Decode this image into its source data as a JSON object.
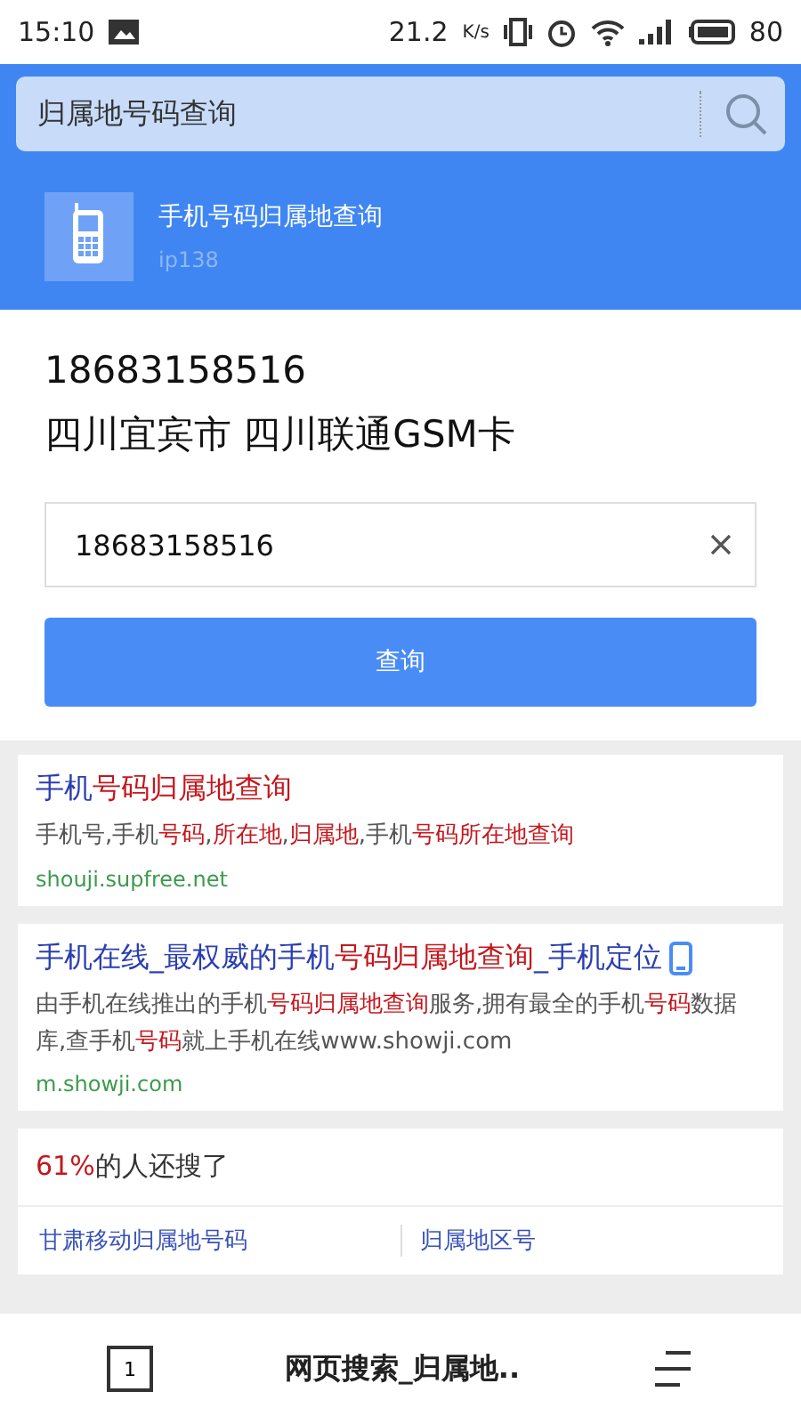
{
  "status_bar": {
    "time": "15:10",
    "speed": "21.2",
    "speed_unit": "K/s",
    "battery": "80"
  },
  "search": {
    "query": "归属地号码查询"
  },
  "app_card": {
    "title": "手机号码归属地查询",
    "source": "ip138"
  },
  "result": {
    "number": "18683158516",
    "location": "四川宜宾市 四川联通GSM卡"
  },
  "lookup": {
    "value": "18683158516",
    "button": "查询"
  },
  "results": [
    {
      "title": "手机**号码归属地查询**",
      "snippet": "手机号,手机**号码**,**所在地**,**归属地**,手机**号码所在地查询**",
      "url": "shouji.supfree.net",
      "mobile_badge": false
    },
    {
      "title": "手机在线_最权威的手机**号码归属地查询**_手机定位",
      "snippet": "由手机在线推出的手机**号码归属地查询**服务,拥有最全的手机**号码**数据库,查手机**号码**就上手机在线www.showji.com",
      "url": "m.showji.com",
      "mobile_badge": true
    }
  ],
  "related": {
    "percent": "61%",
    "label": "的人还搜了",
    "items": [
      "甘肃移动归属地号码",
      "归属地区号"
    ]
  },
  "bottom_bar": {
    "tabs_count": "1",
    "title": "网页搜索_归属地.."
  }
}
